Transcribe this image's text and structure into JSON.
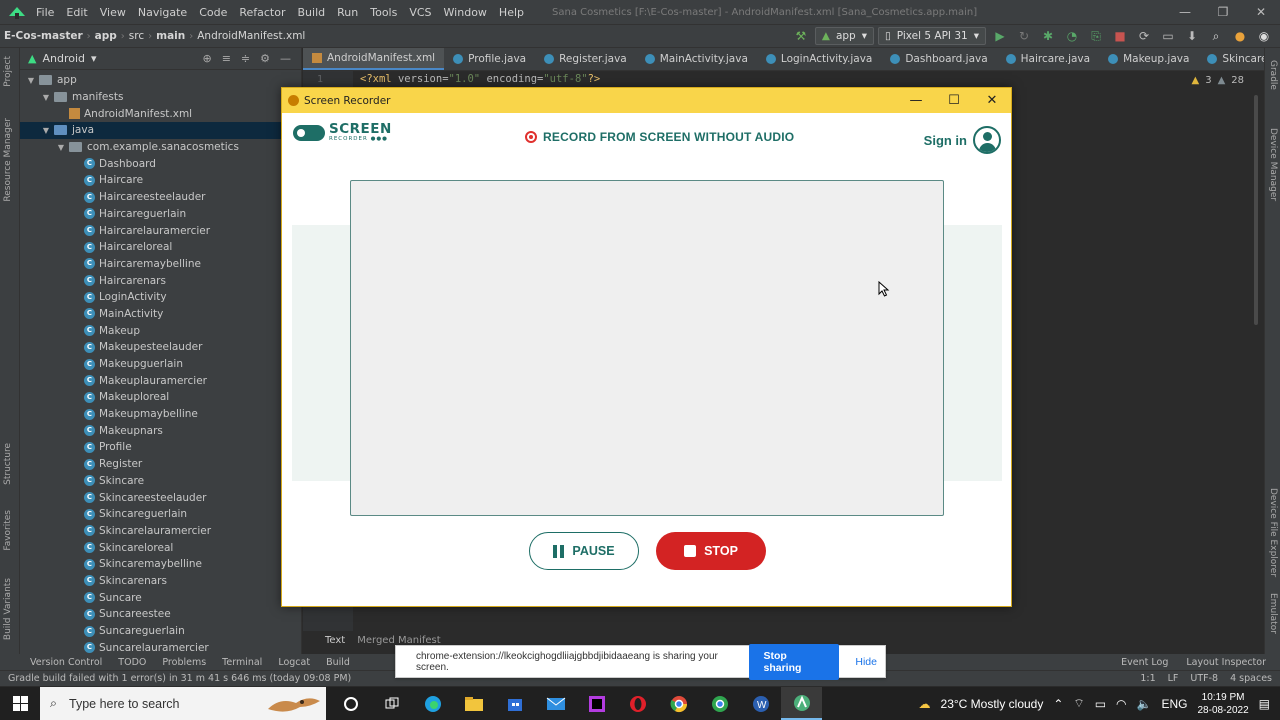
{
  "ide": {
    "menu": [
      "File",
      "Edit",
      "View",
      "Navigate",
      "Code",
      "Refactor",
      "Build",
      "Run",
      "Tools",
      "VCS",
      "Window",
      "Help"
    ],
    "window_title": "Sana Cosmetics [F:\\E-Cos-master] - AndroidManifest.xml [Sana_Cosmetics.app.main]",
    "breadcrumbs": [
      "E-Cos-master",
      "app",
      "src",
      "main",
      "AndroidManifest.xml"
    ],
    "run_config": "app",
    "device": "Pixel 5 API 31",
    "project_view": "Android",
    "tree": [
      {
        "label": "app",
        "type": "folder",
        "level": 0
      },
      {
        "label": "manifests",
        "type": "folder",
        "level": 1
      },
      {
        "label": "AndroidManifest.xml",
        "type": "xml",
        "level": 2
      },
      {
        "label": "java",
        "type": "folder-blue",
        "level": 1
      },
      {
        "label": "com.example.sanacosmetics",
        "type": "folder",
        "level": 2
      },
      {
        "label": "Dashboard",
        "type": "class",
        "level": 3
      },
      {
        "label": "Haircare",
        "type": "class",
        "level": 3
      },
      {
        "label": "Haircareesteelauder",
        "type": "class",
        "level": 3
      },
      {
        "label": "Haircareguerlain",
        "type": "class",
        "level": 3
      },
      {
        "label": "Haircarelauramercier",
        "type": "class",
        "level": 3
      },
      {
        "label": "Haircareloreal",
        "type": "class",
        "level": 3
      },
      {
        "label": "Haircaremaybelline",
        "type": "class",
        "level": 3
      },
      {
        "label": "Haircarenars",
        "type": "class",
        "level": 3
      },
      {
        "label": "LoginActivity",
        "type": "class",
        "level": 3
      },
      {
        "label": "MainActivity",
        "type": "class",
        "level": 3
      },
      {
        "label": "Makeup",
        "type": "class",
        "level": 3
      },
      {
        "label": "Makeupesteelauder",
        "type": "class",
        "level": 3
      },
      {
        "label": "Makeupguerlain",
        "type": "class",
        "level": 3
      },
      {
        "label": "Makeuplauramercier",
        "type": "class",
        "level": 3
      },
      {
        "label": "Makeuploreal",
        "type": "class",
        "level": 3
      },
      {
        "label": "Makeupmaybelline",
        "type": "class",
        "level": 3
      },
      {
        "label": "Makeupnars",
        "type": "class",
        "level": 3
      },
      {
        "label": "Profile",
        "type": "class",
        "level": 3
      },
      {
        "label": "Register",
        "type": "class",
        "level": 3
      },
      {
        "label": "Skincare",
        "type": "class",
        "level": 3
      },
      {
        "label": "Skincareesteelauder",
        "type": "class",
        "level": 3
      },
      {
        "label": "Skincareguerlain",
        "type": "class",
        "level": 3
      },
      {
        "label": "Skincarelauramercier",
        "type": "class",
        "level": 3
      },
      {
        "label": "Skincareloreal",
        "type": "class",
        "level": 3
      },
      {
        "label": "Skincaremaybelline",
        "type": "class",
        "level": 3
      },
      {
        "label": "Skincarenars",
        "type": "class",
        "level": 3
      },
      {
        "label": "Suncare",
        "type": "class",
        "level": 3
      },
      {
        "label": "Suncareestee",
        "type": "class",
        "level": 3
      },
      {
        "label": "Suncareguerlain",
        "type": "class",
        "level": 3
      },
      {
        "label": "Suncarelauramercier",
        "type": "class",
        "level": 3
      }
    ],
    "editor_tabs": [
      {
        "label": "AndroidManifest.xml",
        "kind": "xml",
        "active": true
      },
      {
        "label": "Profile.java",
        "kind": "class"
      },
      {
        "label": "Register.java",
        "kind": "class"
      },
      {
        "label": "MainActivity.java",
        "kind": "class"
      },
      {
        "label": "LoginActivity.java",
        "kind": "class"
      },
      {
        "label": "Dashboard.java",
        "kind": "class"
      },
      {
        "label": "Haircare.java",
        "kind": "class"
      },
      {
        "label": "Makeup.java",
        "kind": "class"
      },
      {
        "label": "Skincare.j",
        "kind": "class"
      }
    ],
    "code": {
      "line_no": "1",
      "tag_open": "<?xml ",
      "version_attr": "version=",
      "version_val": "\"1.0\"",
      "encoding_attr": " encoding=",
      "encoding_val": "\"utf-8\"",
      "tag_close": "?>"
    },
    "inspections": {
      "warnings": "3",
      "weak": "28"
    },
    "editor_bottom_tabs": [
      "Text",
      "Merged Manifest"
    ],
    "tool_tabs": [
      "Version Control",
      "TODO",
      "Problems",
      "Terminal",
      "Logcat",
      "Build"
    ],
    "tool_tabs_right": [
      "Event Log",
      "Layout Inspector"
    ],
    "status": "Gradle build failed with 1 error(s) in 31 m 41 s 646 ms (today 09:08 PM)",
    "status_right": [
      "1:1",
      "LF",
      "UTF-8",
      "4 spaces"
    ],
    "left_strip": [
      "Project",
      "Resource Manager",
      "Structure",
      "Favorites",
      "Build Variants"
    ],
    "right_strip": [
      "Gradle",
      "Device Manager",
      "Device File Explorer",
      "Emulator"
    ]
  },
  "recorder": {
    "title": "Screen Recorder",
    "brand_word": "SCREEN",
    "brand_sub": "RECORDER",
    "mode": "RECORD FROM SCREEN WITHOUT AUDIO",
    "signin": "Sign in",
    "pause_label": "PAUSE",
    "stop_label": "STOP"
  },
  "share_bar": {
    "message": "chrome-extension://lkeokcighogdliiajgbbdjibidaaeang is sharing your screen.",
    "stop_label": "Stop sharing",
    "hide_label": "Hide"
  },
  "taskbar": {
    "search_placeholder": "Type here to search",
    "weather": "23°C  Mostly cloudy",
    "language": "ENG",
    "time": "10:19 PM",
    "date": "28-08-2022"
  },
  "colors": {
    "brand": "#1e6e66",
    "stop": "#d32323",
    "titlebar": "#f9d54a",
    "ide_bg": "#2b2b2b"
  }
}
